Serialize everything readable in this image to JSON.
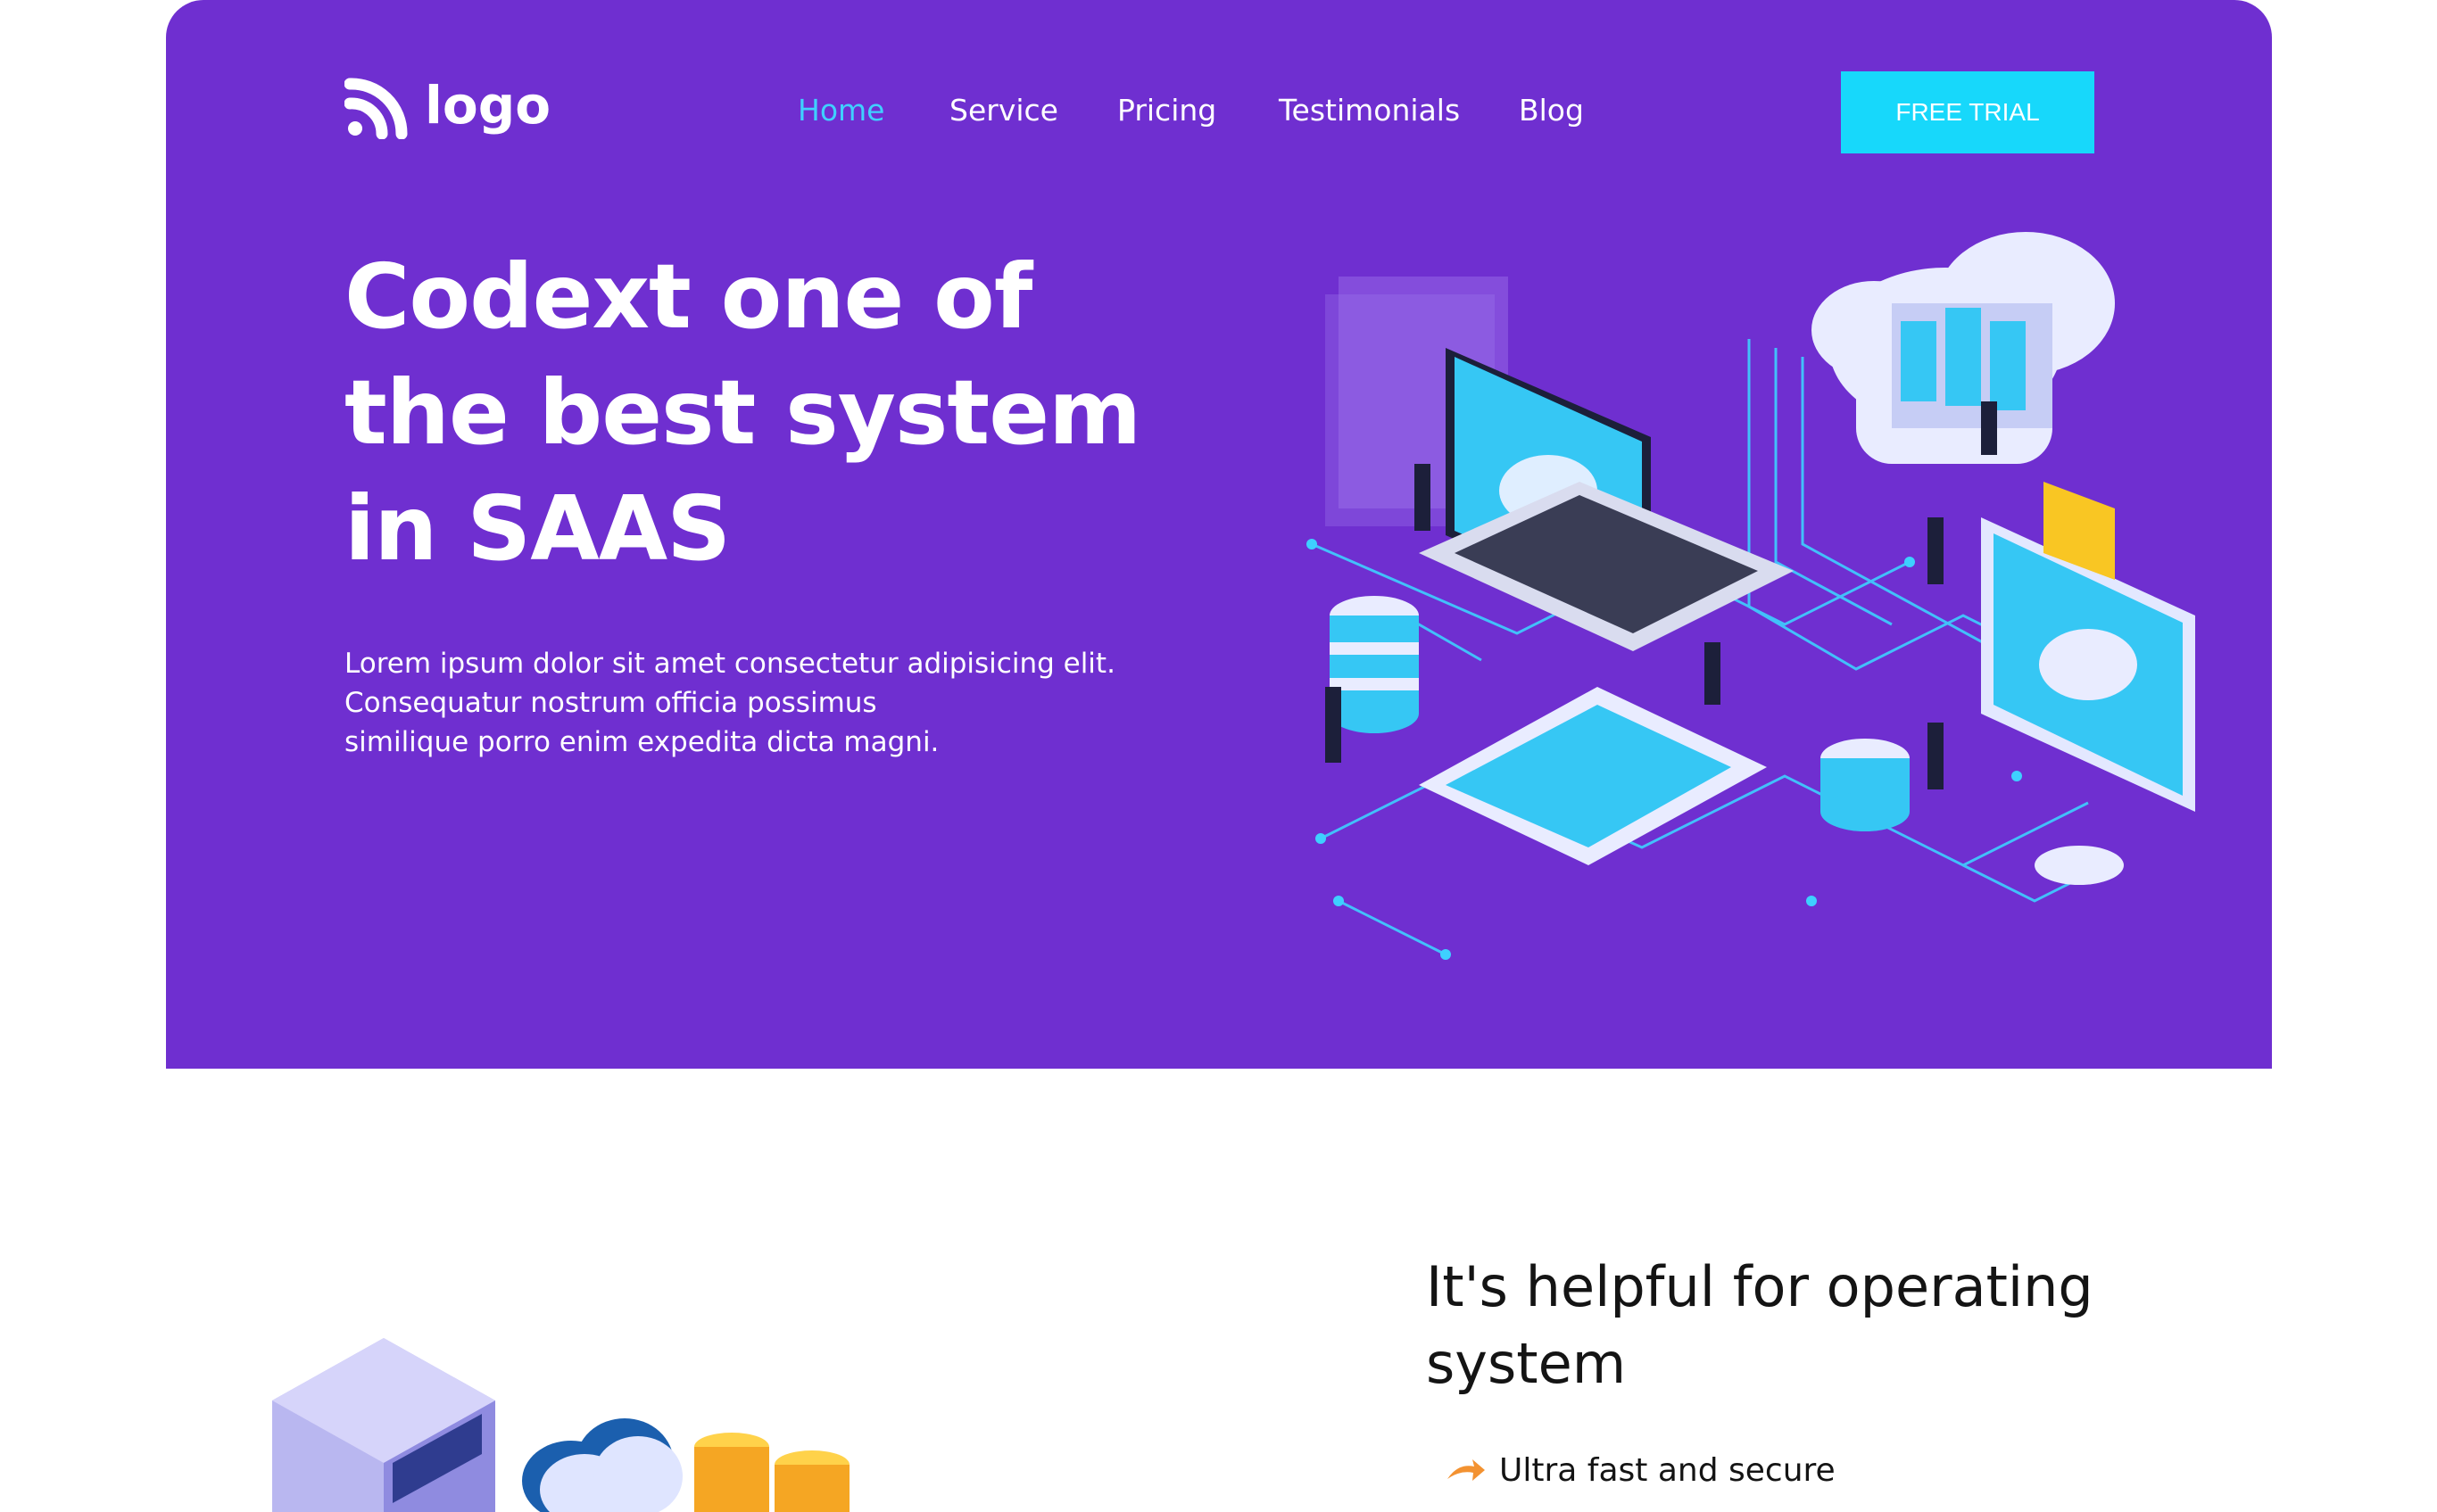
{
  "brand": {
    "logo_text": "logo",
    "logo_icon": "wifi-arcs-icon"
  },
  "colors": {
    "hero_bg": "#6f2fd0",
    "nav_active": "#3fd0ff",
    "cta_bg": "#17d8fb",
    "accent_cyan": "#24c3f5",
    "arrow_orange": "#f39231"
  },
  "nav": {
    "items": [
      {
        "label": "Home",
        "active": true
      },
      {
        "label": "Service",
        "active": false
      },
      {
        "label": "Pricing",
        "active": false
      },
      {
        "label": "Testimonials",
        "active": false
      },
      {
        "label": "Blog",
        "active": false
      }
    ],
    "cta_label": "FREE TRIAL"
  },
  "hero": {
    "headline_line1": "Codext one of",
    "headline_line2": "the best system",
    "headline_line3": "in SAAS",
    "sub_line1": "Lorem ipsum dolor sit amet consectetur adipisicing elit.",
    "sub_line2": "Consequatur nostrum officia possimus",
    "sub_line3": "similique porro enim expedita dicta magni."
  },
  "section2": {
    "title_line1": "It's helpful for operating",
    "title_line2": "system",
    "features": [
      {
        "label": "Ultra fast and secure",
        "icon": "arrow-icon"
      }
    ]
  }
}
